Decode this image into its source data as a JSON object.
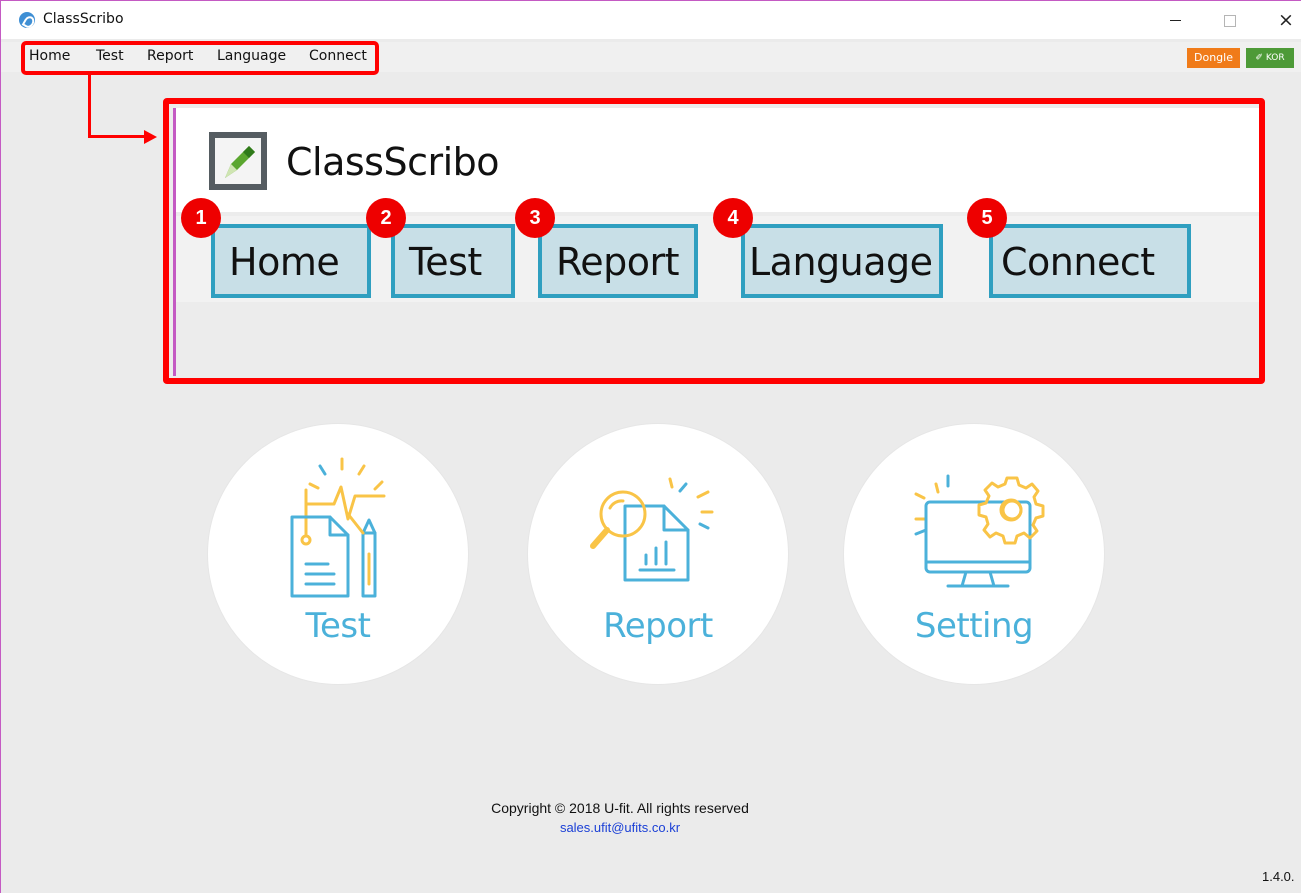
{
  "window": {
    "title": "ClassScribo",
    "close_glyph": "×"
  },
  "menu": [
    "Home",
    "Test",
    "Report",
    "Language",
    "Connect"
  ],
  "badges": {
    "dongle": "Dongle",
    "kor": "✐ KOR"
  },
  "zoom": {
    "title": "ClassScribo",
    "buttons": [
      {
        "num": "1",
        "label": "Home"
      },
      {
        "num": "2",
        "label": "Test"
      },
      {
        "num": "3",
        "label": "Report"
      },
      {
        "num": "4",
        "label": "Language"
      },
      {
        "num": "5",
        "label": "Connect"
      }
    ]
  },
  "tiles": [
    {
      "label": "Test",
      "icon": "test-document-pencil-icon"
    },
    {
      "label": "Report",
      "icon": "report-magnifier-chart-icon"
    },
    {
      "label": "Setting",
      "icon": "monitor-gear-icon"
    }
  ],
  "footer": {
    "copyright": "Copyright © 2018  U-fit. All rights reserved",
    "email": "sales.ufit@ufits.co.kr",
    "version": "1.4.0."
  },
  "colors": {
    "annotation_red": "#ff0000",
    "accent_blue": "#4bb1da",
    "accent_yellow": "#f9c447",
    "dongle": "#f07b19",
    "kor": "#4d9a37"
  }
}
